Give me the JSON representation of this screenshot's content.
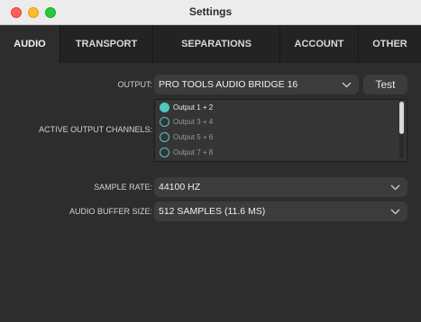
{
  "window": {
    "title": "Settings"
  },
  "tabs": [
    {
      "label": "AUDIO"
    },
    {
      "label": "TRANSPORT"
    },
    {
      "label": "SEPARATIONS"
    },
    {
      "label": "ACCOUNT"
    },
    {
      "label": "OTHER"
    }
  ],
  "audio": {
    "output_label": "OUTPUT:",
    "output_value": "PRO TOOLS AUDIO BRIDGE 16",
    "test_label": "Test",
    "channels_label": "ACTIVE OUTPUT CHANNELS:",
    "channels": [
      {
        "label": "Output 1 + 2",
        "selected": true
      },
      {
        "label": "Output 3 + 4",
        "selected": false
      },
      {
        "label": "Output 5 + 6",
        "selected": false
      },
      {
        "label": "Output 7 + 8",
        "selected": false
      }
    ],
    "sample_rate_label": "SAMPLE RATE:",
    "sample_rate_value": "44100 HZ",
    "buffer_label": "AUDIO BUFFER SIZE:",
    "buffer_value": "512 SAMPLES (11.6 MS)"
  },
  "icons": {
    "dropdown": "chevron-down-icon",
    "radio": "radio-icon"
  },
  "colors": {
    "accent": "#4fc8c0",
    "background": "#2d2d2d",
    "tab_bar": "#232323"
  }
}
